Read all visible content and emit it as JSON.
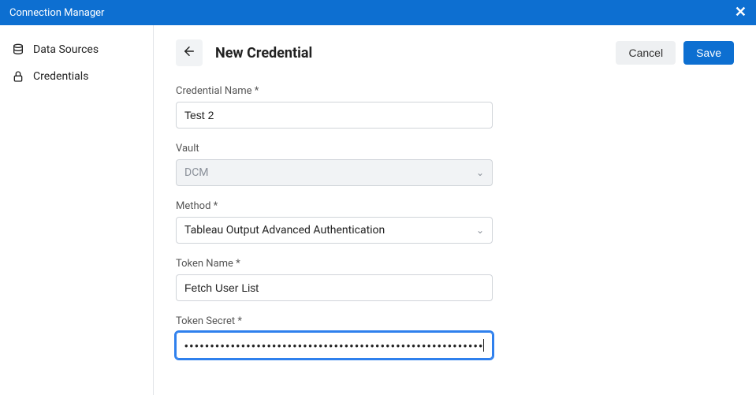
{
  "window": {
    "title": "Connection Manager"
  },
  "sidebar": {
    "items": [
      {
        "label": "Data Sources"
      },
      {
        "label": "Credentials"
      }
    ]
  },
  "header": {
    "title": "New Credential",
    "cancel_label": "Cancel",
    "save_label": "Save"
  },
  "form": {
    "credential_name": {
      "label": "Credential Name *",
      "value": "Test 2"
    },
    "vault": {
      "label": "Vault",
      "value": "DCM",
      "disabled": true
    },
    "method": {
      "label": "Method *",
      "value": "Tableau Output Advanced Authentication"
    },
    "token_name": {
      "label": "Token Name *",
      "value": "Fetch User List"
    },
    "token_secret": {
      "label": "Token Secret *",
      "masked_value": "•••••••••••••••••••••••••••••••••••••••••••••••••••••••••••••••"
    }
  }
}
